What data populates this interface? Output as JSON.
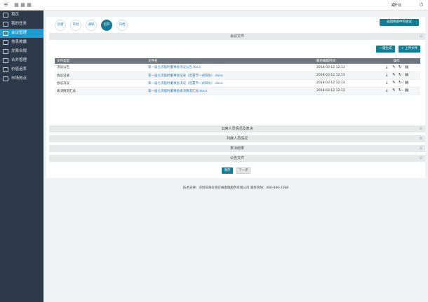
{
  "topbar": {
    "about": "关于我"
  },
  "sidebar": {
    "items": [
      {
        "label": "首页"
      },
      {
        "label": "我的任务"
      },
      {
        "label": "会议管理"
      },
      {
        "label": "信息披露"
      },
      {
        "label": "交易合规"
      },
      {
        "label": "合并管理"
      },
      {
        "label": "价值追率"
      },
      {
        "label": "市场热点"
      }
    ]
  },
  "steps": [
    {
      "label": "创建"
    },
    {
      "label": "审批"
    },
    {
      "label": "通知"
    },
    {
      "label": "召开"
    },
    {
      "label": "归档"
    }
  ],
  "return_button": "返回筹备中的会议",
  "section_meeting_files": "会议文件",
  "buttons": {
    "generate": "一键生成",
    "upload": "+ 上传文件"
  },
  "table": {
    "headers": [
      "文件类型",
      "文件名",
      "最后编辑时间",
      "操作"
    ],
    "rows": [
      {
        "type": "决议公告",
        "name": "第一届七次临时董事会决议公告.docx",
        "time": "2018-03-12 12:13"
      },
      {
        "type": "会议记录",
        "name": "第一届七次临时董事会记录（签署节一式四份）.docx",
        "time": "2018-03-12 12:13"
      },
      {
        "type": "会议决议",
        "name": "第一届七次临时董事会决议（签署节一式四份）.docx",
        "time": "2018-03-12 12:13"
      },
      {
        "type": "表决情况汇总",
        "name": "第一届七次临时董事会表决情况汇总.docx",
        "time": "2018-03-12 12:13"
      }
    ]
  },
  "sections": [
    {
      "label": "出席人员情况及表决"
    },
    {
      "label": "列席人员情况"
    },
    {
      "label": "表决结果"
    },
    {
      "label": "公告文件"
    }
  ],
  "form_buttons": {
    "save": "保存",
    "next": "下一步"
  },
  "footer": "技术支持：深圳前海价值在线金融服务有限公司  服务热线：400-880-2388"
}
